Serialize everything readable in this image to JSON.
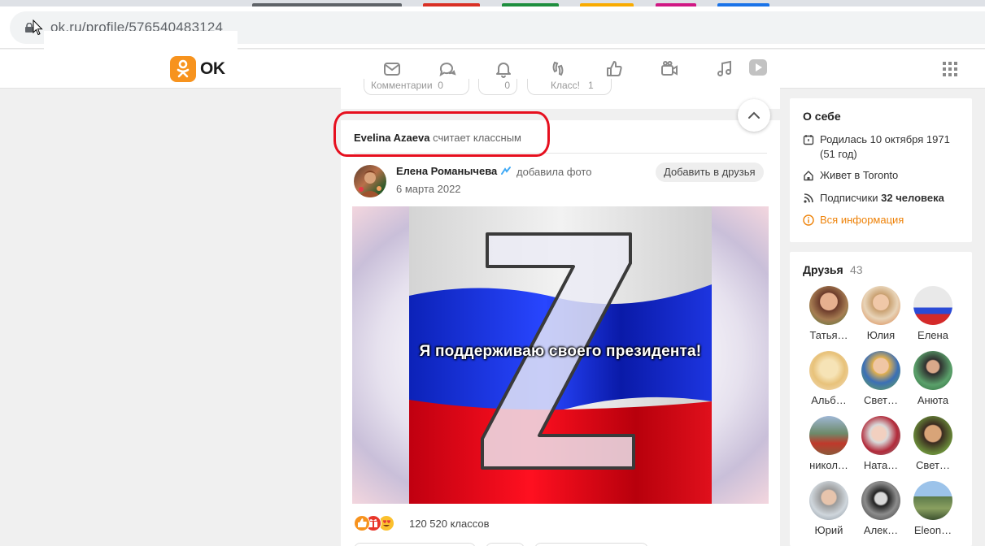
{
  "browser": {
    "url": "ok.ru/profile/576540483124"
  },
  "brand": {
    "wordmark": "OK",
    "accent": "#f7931e"
  },
  "nav": {
    "icons": [
      "messages-icon",
      "discussions-icon",
      "notifications-icon",
      "guests-icon",
      "likes-icon",
      "video-icon",
      "music-icon",
      "video-play-icon",
      "apps-grid-icon"
    ]
  },
  "prev_post": {
    "comment_label": "Комментарии",
    "comment_count": "0",
    "share_count": "0",
    "like_label": "Класс!",
    "like_count": "1"
  },
  "post": {
    "actor": "Evelina Azaeva",
    "action": "считает классным",
    "author": "Елена Романычева",
    "author_action": "добавила фото",
    "date": "6 марта 2022",
    "add_friend_label": "Добавить в друзья",
    "image_caption": "Я поддерживаю своего президента!",
    "reactions_count": "120 520 классов",
    "highlight_color": "#e60f1e"
  },
  "about": {
    "title": "О себе",
    "born_line1": "Родилась 10 октября 1971",
    "born_line2": "(51 год)",
    "lives": "Живет в Toronto",
    "subscribers_label": "Подписчики",
    "subscribers_value": "32 человека",
    "all_info": "Вся информация"
  },
  "friends": {
    "title": "Друзья",
    "count": "43",
    "items": [
      {
        "name": "Татья…"
      },
      {
        "name": "Юлия"
      },
      {
        "name": "Елена"
      },
      {
        "name": "Альб…"
      },
      {
        "name": "Свет…"
      },
      {
        "name": "Анюта"
      },
      {
        "name": "никол…"
      },
      {
        "name": "Ната…"
      },
      {
        "name": "Свет…"
      },
      {
        "name": "Юрий"
      },
      {
        "name": "Алек…"
      },
      {
        "name": "Eleon…"
      }
    ]
  }
}
